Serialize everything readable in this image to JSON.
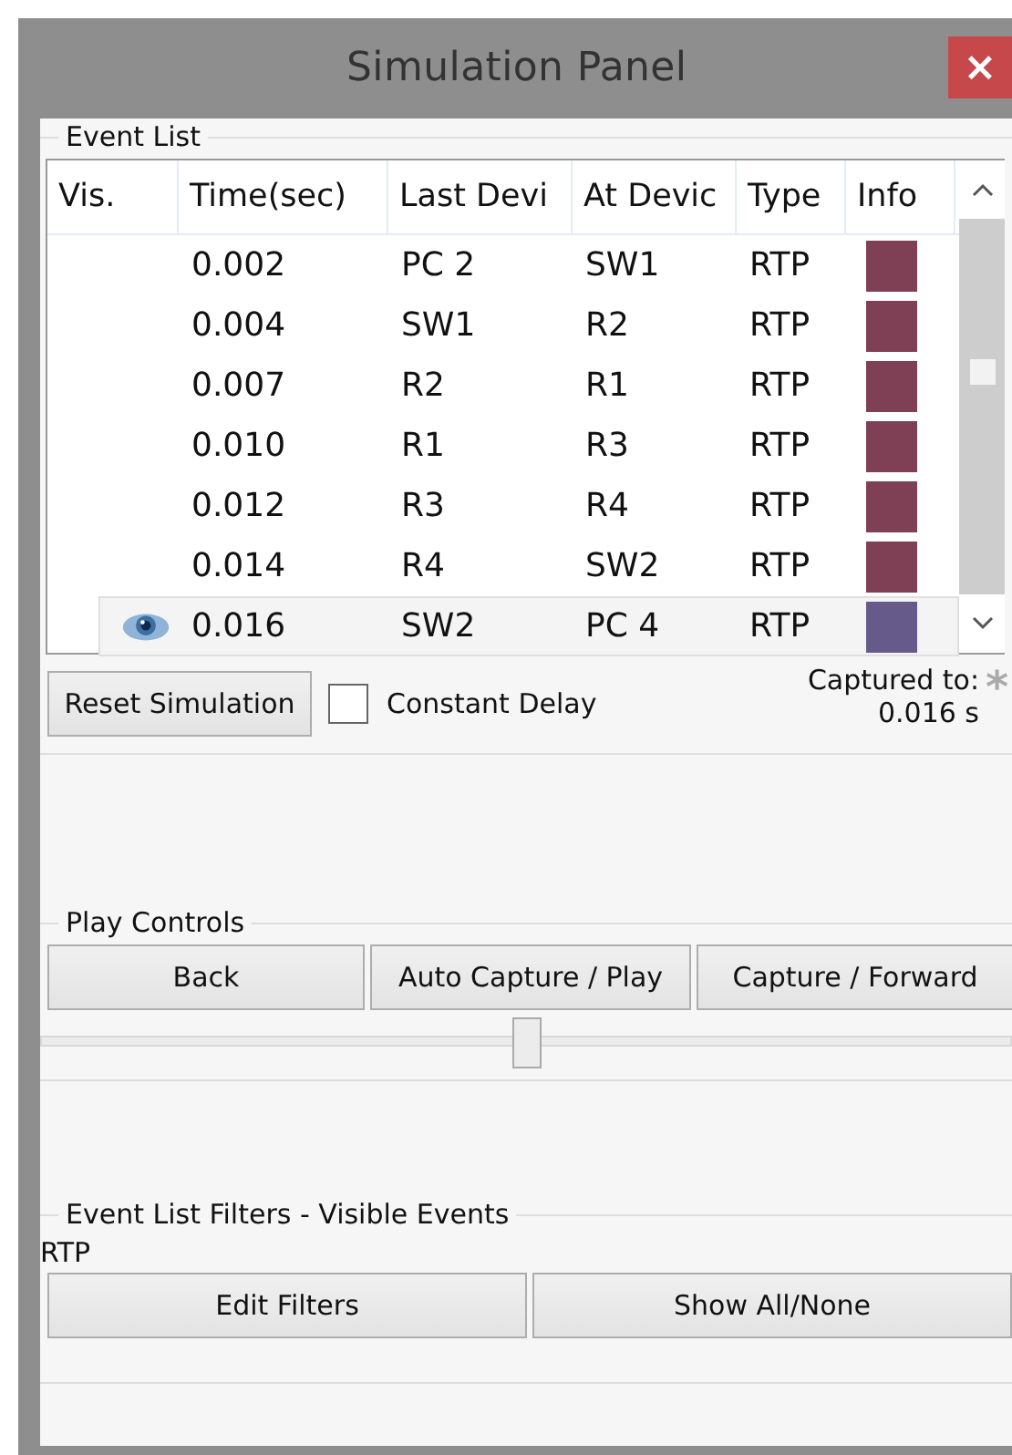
{
  "window": {
    "title": "Simulation Panel",
    "close": "×"
  },
  "event_list": {
    "title": "Event List",
    "columns": [
      "Vis.",
      "Time(sec)",
      "Last Devi",
      "At Devic",
      "Type",
      "Info"
    ],
    "rows": [
      {
        "visible": false,
        "selected": false,
        "time": "0.002",
        "last_device": "PC 2",
        "at_device": "SW1",
        "type": "RTP",
        "color": "#7f3f55"
      },
      {
        "visible": false,
        "selected": false,
        "time": "0.004",
        "last_device": "SW1",
        "at_device": "R2",
        "type": "RTP",
        "color": "#7f3f55"
      },
      {
        "visible": false,
        "selected": false,
        "time": "0.007",
        "last_device": "R2",
        "at_device": "R1",
        "type": "RTP",
        "color": "#7f3f55"
      },
      {
        "visible": false,
        "selected": false,
        "time": "0.010",
        "last_device": "R1",
        "at_device": "R3",
        "type": "RTP",
        "color": "#7f3f55"
      },
      {
        "visible": false,
        "selected": false,
        "time": "0.012",
        "last_device": "R3",
        "at_device": "R4",
        "type": "RTP",
        "color": "#7f3f55"
      },
      {
        "visible": false,
        "selected": false,
        "time": "0.014",
        "last_device": "R4",
        "at_device": "SW2",
        "type": "RTP",
        "color": "#7f3f55"
      },
      {
        "visible": true,
        "selected": true,
        "time": "0.016",
        "last_device": "SW2",
        "at_device": "PC 4",
        "type": "RTP",
        "color": "#655a8a"
      }
    ]
  },
  "reset_button": "Reset Simulation",
  "constant_delay": {
    "label": "Constant Delay",
    "checked": false
  },
  "captured": {
    "label": "Captured to:",
    "value": "0.016 s",
    "marker": "*"
  },
  "play_controls": {
    "title": "Play Controls",
    "buttons": [
      "Back",
      "Auto Capture / Play",
      "Capture / Forward"
    ],
    "slider": {
      "level": 0.5
    }
  },
  "filters": {
    "title": "Event List Filters - Visible Events",
    "visible_types": "RTP",
    "buttons": [
      "Edit Filters",
      "Show All/None"
    ]
  }
}
